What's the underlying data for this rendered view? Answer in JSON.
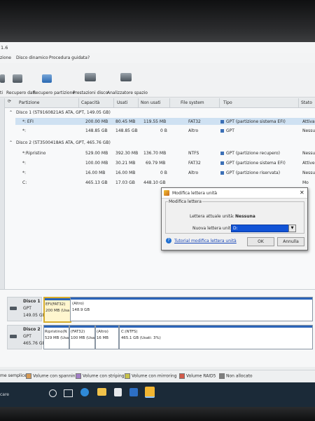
{
  "app": {
    "version": "1.6"
  },
  "menu": [
    {
      "label": "zione"
    },
    {
      "label": "Disco dinamico"
    },
    {
      "label": "Procedura guidata"
    },
    {
      "label": "?"
    }
  ],
  "toolbar": [
    {
      "label": "ti"
    },
    {
      "label": "Recupero dati"
    },
    {
      "label": "Recupero partizione"
    },
    {
      "label": "Prestazioni disco"
    },
    {
      "label": "Analizzatore spazio"
    }
  ],
  "grid": {
    "columns": [
      "Partizione",
      "Capacità",
      "Usati",
      "Non usati",
      "File system",
      "Tipo",
      "Stato"
    ],
    "disk1_header": "Disco 1 (ST9160821AS ATA, GPT, 149.05 GB)",
    "disk1_rows": [
      {
        "part": "*: EFI",
        "cap": "200.00 MB",
        "used": "80.45 MB",
        "free": "119.55 MB",
        "fs": "FAT32",
        "type": "GPT (partizione sistema EFI)",
        "state": "Attiva"
      },
      {
        "part": "*:",
        "cap": "148.85 GB",
        "used": "148.85 GB",
        "free": "0 B",
        "fs": "Altro",
        "type": "GPT",
        "state": "Nessu"
      }
    ],
    "disk2_header": "Disco 2 (ST3500418AS ATA, GPT, 465.76 GB)",
    "disk2_rows": [
      {
        "part": "*:Ripristino",
        "cap": "529.00 MB",
        "used": "392.30 MB",
        "free": "136.70 MB",
        "fs": "NTFS",
        "type": "GPT (partizione recupero)",
        "state": "Nessu"
      },
      {
        "part": "*:",
        "cap": "100.00 MB",
        "used": "30.21 MB",
        "free": "69.79 MB",
        "fs": "FAT32",
        "type": "GPT (partizione sistema EFI)",
        "state": "Attive"
      },
      {
        "part": "*:",
        "cap": "16.00 MB",
        "used": "16.00 MB",
        "free": "0 B",
        "fs": "Altro",
        "type": "GPT (partizione riservata)",
        "state": "Nessu"
      },
      {
        "part": "C:",
        "cap": "465.13 GB",
        "used": "17.03 GB",
        "free": "448.10 GB",
        "fs": "",
        "type": "",
        "state": "Mo"
      }
    ]
  },
  "dialog": {
    "title": "Modifica lettera unità",
    "group_title": "Modifica lettera",
    "current_label": "Lettera attuale unità:",
    "current_value": "Nessuna",
    "new_label": "Nuova lettera unità:",
    "new_value": "D:",
    "tutorial_link": "Tutorial modifica lettera unità",
    "ok": "OK",
    "cancel": "Annulla"
  },
  "diskmap": {
    "disk1": {
      "name": "Disco 1",
      "scheme": "GPT",
      "size": "149.05 GB",
      "parts": [
        {
          "l1": "EFI(FAT32)",
          "l2": "200 MB (Usa"
        },
        {
          "l1": "(Altro)",
          "l2": "148.9 GB"
        }
      ]
    },
    "disk2": {
      "name": "Disco 2",
      "scheme": "GPT",
      "size": "465.76 GB",
      "parts": [
        {
          "l1": "Ripristino(N",
          "l2": "529 MB (Usa"
        },
        {
          "l1": "(FAT32)",
          "l2": "100 MB (Usa"
        },
        {
          "l1": "(Altro)",
          "l2": "16 MB"
        },
        {
          "l1": "C:(NTFS)",
          "l2": "465.1 GB (Usati: 3%)"
        }
      ]
    }
  },
  "legend": [
    {
      "label": "me semplice",
      "color": "#f4f4f4"
    },
    {
      "label": "Volume con spanning",
      "color": "#d69a54"
    },
    {
      "label": "Volume con striping",
      "color": "#a27ec6"
    },
    {
      "label": "Volume con mirroring",
      "color": "#c8c24a"
    },
    {
      "label": "Volume RAID5",
      "color": "#d25a4a"
    },
    {
      "label": "Non allocato",
      "color": "#7f7f7f"
    }
  ],
  "taskbar": {
    "search_fragment": "care"
  }
}
